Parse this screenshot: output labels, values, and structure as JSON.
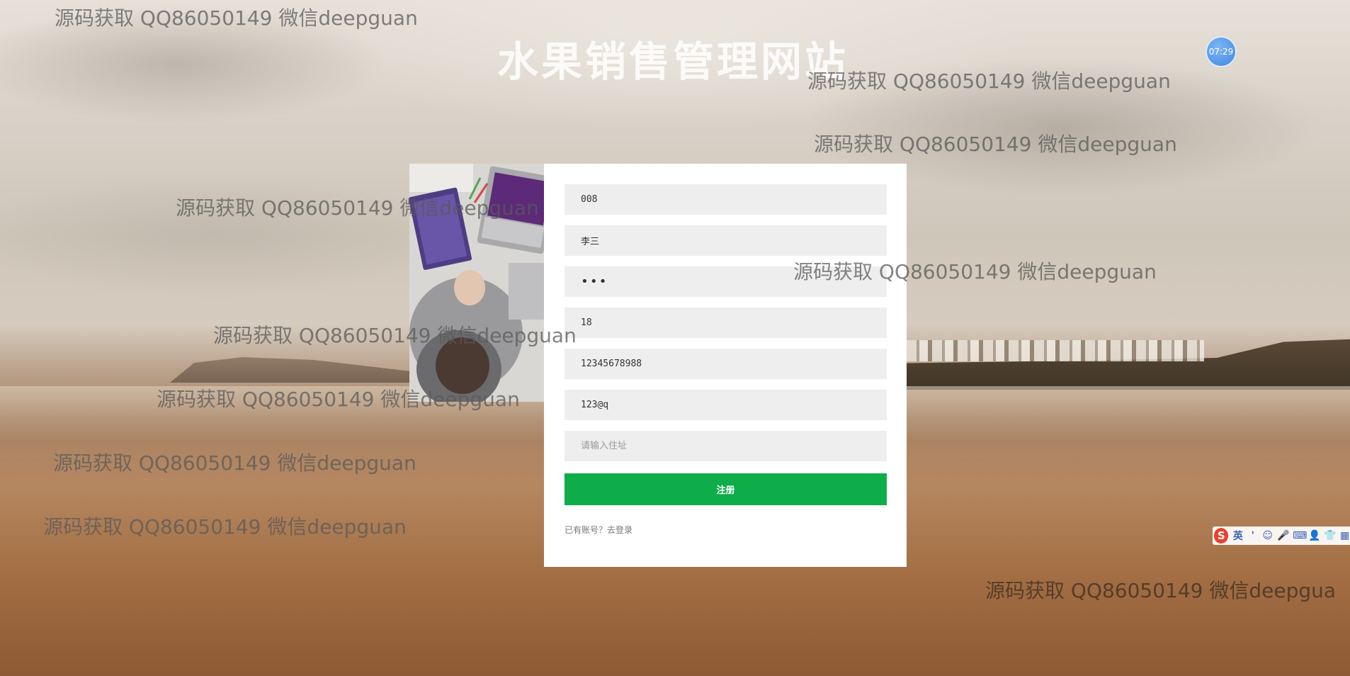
{
  "title": "水果销售管理网站",
  "clock": "07:29",
  "form": {
    "fields": [
      {
        "value": "008",
        "placeholder": ""
      },
      {
        "value": "李三",
        "placeholder": ""
      },
      {
        "value": "•••",
        "placeholder": ""
      },
      {
        "value": "18",
        "placeholder": ""
      },
      {
        "value": "12345678988",
        "placeholder": ""
      },
      {
        "value": "123@q",
        "placeholder": ""
      },
      {
        "value": "",
        "placeholder": "请输入住址"
      }
    ],
    "submit_label": "注册",
    "login_link": "已有账号？去登录"
  },
  "watermark_text": "源码获取 QQ86050149 微信deepguan",
  "watermark_text_cut": "源码获取 QQ86050149 微信deepgua",
  "ime": {
    "logo": "S",
    "items": [
      "英",
      "'",
      "☺",
      "🎤",
      "⌨",
      "👤",
      "👕",
      "▦"
    ]
  }
}
